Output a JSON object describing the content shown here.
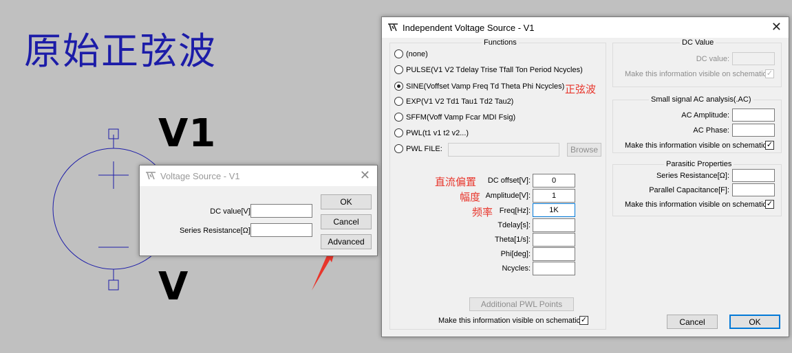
{
  "schematic": {
    "title": "原始正弦波",
    "component_label_top": "V1",
    "component_label_bottom": "V"
  },
  "small_dialog": {
    "title": "Voltage Source - V1",
    "dc_value_label": "DC value[V]:",
    "series_resistance_label": "Series Resistance[Ω]:",
    "ok": "OK",
    "cancel": "Cancel",
    "advanced": "Advanced"
  },
  "main_dialog": {
    "title": "Independent Voltage Source - V1",
    "functions": {
      "title": "Functions",
      "options": [
        {
          "label": "(none)",
          "selected": false
        },
        {
          "label": "PULSE(V1 V2 Tdelay Trise Tfall Ton Period Ncycles)",
          "selected": false
        },
        {
          "label": "SINE(Voffset Vamp Freq Td Theta Phi Ncycles)",
          "selected": true
        },
        {
          "label": "EXP(V1 V2 Td1 Tau1 Td2 Tau2)",
          "selected": false
        },
        {
          "label": "SFFM(Voff Vamp Fcar MDI Fsig)",
          "selected": false
        },
        {
          "label": "PWL(t1 v1 t2 v2...)",
          "selected": false
        },
        {
          "label": "PWL FILE:",
          "selected": false
        }
      ],
      "browse": "Browse"
    },
    "sine_params": [
      {
        "label": "DC offset[V]:",
        "value": "0"
      },
      {
        "label": "Amplitude[V]:",
        "value": "1"
      },
      {
        "label": "Freq[Hz]:",
        "value": "1K"
      },
      {
        "label": "Tdelay[s]:",
        "value": ""
      },
      {
        "label": "Theta[1/s]:",
        "value": ""
      },
      {
        "label": "Phi[deg]:",
        "value": ""
      },
      {
        "label": "Ncycles:",
        "value": ""
      }
    ],
    "annotations": {
      "sine": "正弦波",
      "dc_offset": "直流偏置",
      "amplitude": "幅度",
      "freq": "频率"
    },
    "additional_pwl": "Additional PWL Points",
    "visible_on_schematic": "Make this information visible on schematic:",
    "dc_value": {
      "title": "DC Value",
      "label": "DC value:",
      "visible": "Make this information visible on schematic:"
    },
    "ac": {
      "title": "Small signal AC analysis(.AC)",
      "amplitude_label": "AC Amplitude:",
      "phase_label": "AC Phase:",
      "visible": "Make this information visible on schematic:"
    },
    "parasitic": {
      "title": "Parasitic Properties",
      "series_resistance_label": "Series Resistance[Ω]:",
      "parallel_capacitance_label": "Parallel Capacitance[F]:",
      "visible": "Make this information visible on schematic:"
    },
    "cancel": "Cancel",
    "ok": "OK"
  },
  "colors": {
    "background": "#c0c0c0",
    "title_blue": "#1c1ca8",
    "annotation_red": "#e8362c",
    "focus_blue": "#0078d7"
  }
}
